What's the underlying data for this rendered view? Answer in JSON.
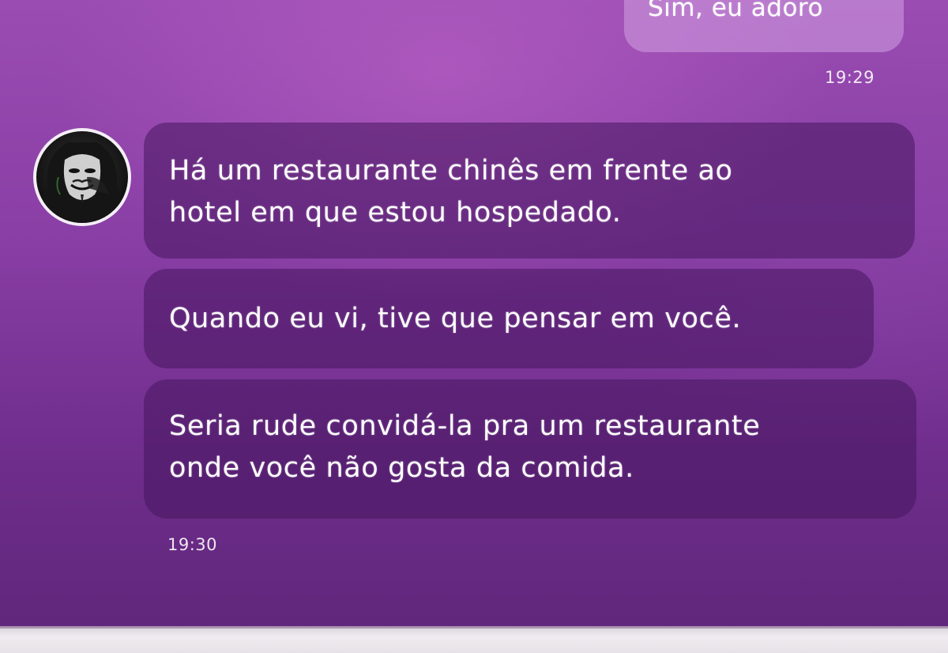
{
  "chat": {
    "outgoing": {
      "text": "Sim, eu adoro",
      "time": "19:29"
    },
    "incoming": {
      "avatar_icon": "guy-fawkes-mask-avatar",
      "messages": [
        {
          "lines": [
            "Há um restaurante chinês em frente ao",
            "hotel em que estou hospedado."
          ]
        },
        {
          "lines": [
            "Quando eu vi, tive que pensar em você."
          ]
        },
        {
          "lines": [
            "Seria rude convidá-la pra um restaurante",
            "onde você não gosta da comida."
          ]
        }
      ],
      "time": "19:30"
    }
  },
  "colors": {
    "background": "#8a3fa6",
    "incoming_bubble": "#46165f",
    "outgoing_bubble": "#d2a0e1",
    "text": "#ffffff"
  }
}
